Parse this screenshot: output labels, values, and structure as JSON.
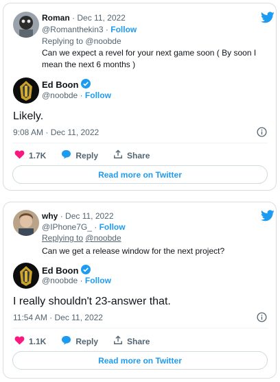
{
  "tweets": [
    {
      "quoted": {
        "name": "Roman",
        "date": "Dec 11, 2022",
        "handle": "@Romanthekin3",
        "follow": "Follow",
        "replying_label": "Replying to",
        "replying_user": "@noobde",
        "text": "Can we expect a revel for your next game soon ( By soon I mean the next 6 months )"
      },
      "author": {
        "name": "Ed Boon",
        "handle": "@noobde",
        "follow": "Follow"
      },
      "text": "Likely.",
      "time": "9:08 AM · Dec 11, 2022",
      "likes": "1.7K",
      "reply_label": "Reply",
      "share_label": "Share",
      "read_more": "Read more on Twitter"
    },
    {
      "quoted": {
        "name": "why",
        "date": "Dec 11, 2022",
        "handle": "@IPhone7G_",
        "follow": "Follow",
        "replying_label": "Replying to",
        "replying_user": "@noobde",
        "text": "Can we get a release window for the next project?"
      },
      "author": {
        "name": "Ed Boon",
        "handle": "@noobde",
        "follow": "Follow"
      },
      "text": "I really shouldn't 23-answer that.",
      "time": "11:54 AM · Dec 11, 2022",
      "likes": "1.1K",
      "reply_label": "Reply",
      "share_label": "Share",
      "read_more": "Read more on Twitter"
    }
  ],
  "colors": {
    "accent": "#1d9bf0",
    "like": "#f91880",
    "muted": "#536471",
    "text": "#0f1419"
  },
  "icons": [
    "twitter-bird-icon",
    "verified-badge-icon",
    "info-icon",
    "heart-icon",
    "reply-bubble-icon",
    "share-icon"
  ]
}
